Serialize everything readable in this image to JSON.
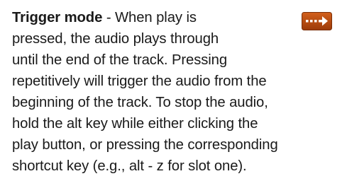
{
  "entry": {
    "term": "Trigger mode",
    "separator": " - ",
    "lines": [
      "When play is",
      "pressed, the audio plays through",
      "until the end of the track. Pressing",
      "repetitively will trigger the audio from the",
      "beginning of the track. To stop the audio,",
      "hold the alt key while either clicking the",
      "play button, or pressing the corresponding",
      "shortcut key (e.g., alt - z for slot one)."
    ],
    "icon": {
      "name": "dotted-arrow-icon",
      "background": "#b84a0e",
      "foreground": "#ffffff"
    }
  }
}
